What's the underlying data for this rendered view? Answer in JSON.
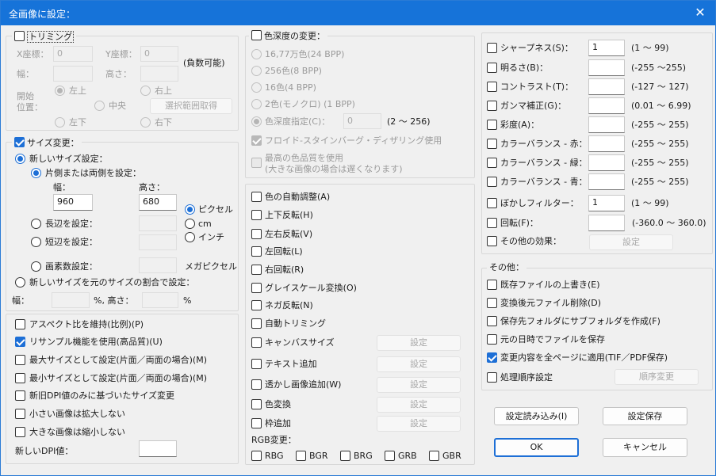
{
  "window": {
    "title": "全画像に設定："
  },
  "trim": {
    "label": "トリミング",
    "x_label": "X座標：",
    "x_value": "0",
    "y_label": "Y座標：",
    "y_value": "0",
    "negative_note": "(負数可能)",
    "width_label": "幅：",
    "height_label": "高さ：",
    "start_label_1": "開始",
    "start_label_2": "位置：",
    "top_left": "左上",
    "top_right": "右上",
    "center": "中央",
    "bottom_left": "左下",
    "bottom_right": "右下",
    "get_selection_button": "選択範囲取得"
  },
  "resize": {
    "label": "サイズ変更：",
    "new_size_label": "新しいサイズ設定：",
    "one_or_both_label": "片側または両側を設定：",
    "width_label": "幅：",
    "height_label": "高さ：",
    "width_value": "960",
    "height_value": "680",
    "unit_pixel": "ピクセル",
    "unit_cm": "cm",
    "unit_inch": "インチ",
    "long_side_label": "長辺を設定：",
    "short_side_label": "短辺を設定：",
    "pixel_count_label": "画素数設定：",
    "megapixel_label": "メガピクセル",
    "ratio_label": "新しいサイズを元のサイズの割合で設定：",
    "ratio_width_label": "幅：",
    "ratio_percent_height": "%, 高さ：",
    "ratio_percent": "%"
  },
  "options": {
    "keep_aspect": "アスペクト比を維持(比例)(P)",
    "resample": "リサンプル機能を使用(高品質)(U)",
    "max_size": "最大サイズとして設定(片面／両面の場合)(M)",
    "min_size": "最小サイズとして設定(片面／両面の場合)(M)",
    "dpi_based": "新旧DPI値のみに基づいたサイズ変更",
    "no_enlarge": "小さい画像は拡大しない",
    "no_shrink": "大きな画像は縮小しない",
    "new_dpi_label": "新しいDPI値："
  },
  "color_depth": {
    "label": "色深度の変更：",
    "opt_16m": "16,77万色(24 BPP)",
    "opt_256": "256色(8 BPP)",
    "opt_16": "16色(4 BPP)",
    "opt_2": "2色(モノクロ) (1 BPP)",
    "opt_custom": "色深度指定(C)：",
    "custom_value": "0",
    "custom_range": "(2 ～ 256)",
    "dither": "フロイド-スタインバーグ・ディザリング使用",
    "best_quality_1": "最高の色品質を使用",
    "best_quality_2": "(大きな画像の場合は遅くなります)"
  },
  "effects": {
    "auto_color": "色の自動調整(A)",
    "flip_v": "上下反転(H)",
    "flip_h": "左右反転(V)",
    "rotate_left": "左回転(L)",
    "rotate_right": "右回転(R)",
    "grayscale": "グレイスケール変換(O)",
    "negative": "ネガ反転(N)",
    "auto_crop": "自動トリミング",
    "canvas_size": "キャンバスサイズ",
    "add_text": "テキスト追加",
    "add_watermark": "透かし画像追加(W)",
    "color_replace": "色変換",
    "add_frame": "枠追加",
    "settings_button": "設定",
    "rgb_label": "RGB変更：",
    "rgb_options": [
      "RBG",
      "BGR",
      "BRG",
      "GRB",
      "GBR"
    ]
  },
  "adjust": {
    "sharpness": {
      "label": "シャープネス(S)：",
      "value": "1",
      "range": "(1 ～ 99)"
    },
    "brightness": {
      "label": "明るさ(B)：",
      "value": "",
      "range": "(-255 ～255)"
    },
    "contrast": {
      "label": "コントラスト(T)：",
      "value": "",
      "range": "(-127 ～ 127)"
    },
    "gamma": {
      "label": "ガンマ補正(G)：",
      "value": "",
      "range": "(0.01 ～ 6.99)"
    },
    "saturation": {
      "label": "彩度(A)：",
      "value": "",
      "range": "(-255 ～ 255)"
    },
    "balance_red": {
      "label": "カラーバランス - 赤：",
      "value": "",
      "range": "(-255 ～ 255)"
    },
    "balance_green": {
      "label": "カラーバランス - 緑：",
      "value": "",
      "range": "(-255 ～ 255)"
    },
    "balance_blue": {
      "label": "カラーバランス - 青：",
      "value": "",
      "range": "(-255 ～ 255)"
    },
    "blur": {
      "label": "ぼかしフィルター：",
      "value": "1",
      "range": "(1 ～ 99)"
    },
    "rotate": {
      "label": "回転(F)：",
      "value": "",
      "range": "(-360.0 ～ 360.0)"
    },
    "other_effects": "その他の効果：",
    "settings_button": "設定"
  },
  "misc": {
    "label": "その他：",
    "overwrite": "既存ファイルの上書き(E)",
    "delete_source": "変換後元ファイル削除(D)",
    "create_subfolder": "保存先フォルダにサブフォルダを作成(F)",
    "keep_date": "元の日時でファイルを保存",
    "apply_all_pages": "変更内容を全ページに適用(TIF／PDF保存)",
    "process_order": "処理順序設定",
    "order_button": "順序変更"
  },
  "footer": {
    "load_settings": "設定読み込み(I)",
    "save_settings": "設定保存",
    "ok": "OK",
    "cancel": "キャンセル"
  },
  "colors": {
    "accent": "#1d6fd6",
    "titlebar": "#1673d9"
  }
}
